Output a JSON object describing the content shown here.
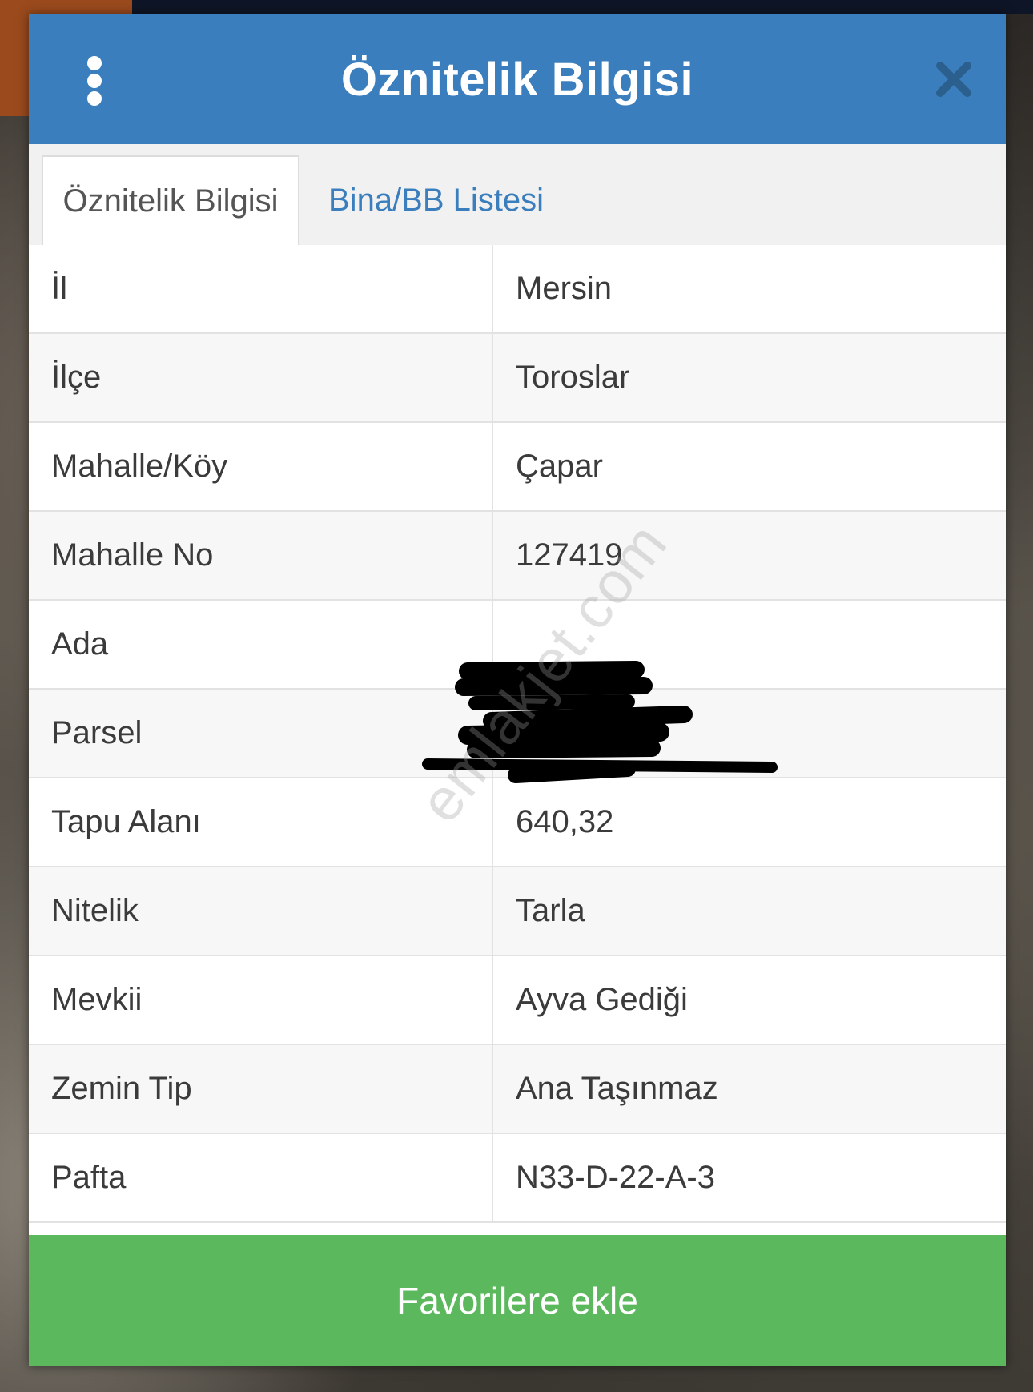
{
  "dialog": {
    "title": "Öznitelik Bilgisi",
    "menu_icon": "kebab-menu-icon",
    "close_icon": "close-icon"
  },
  "tabs": [
    {
      "label": "Öznitelik Bilgisi",
      "active": true
    },
    {
      "label": "Bina/BB Listesi",
      "active": false
    }
  ],
  "attributes": [
    {
      "key": "İl",
      "value": "Mersin"
    },
    {
      "key": "İlçe",
      "value": "Toroslar"
    },
    {
      "key": "Mahalle/Köy",
      "value": "Çapar"
    },
    {
      "key": "Mahalle No",
      "value": "127419"
    },
    {
      "key": "Ada",
      "value": ""
    },
    {
      "key": "Parsel",
      "value": ""
    },
    {
      "key": "Tapu Alanı",
      "value": "640,32"
    },
    {
      "key": "Nitelik",
      "value": "Tarla"
    },
    {
      "key": "Mevkii",
      "value": "Ayva Gediği"
    },
    {
      "key": "Zemin Tip",
      "value": "Ana Taşınmaz"
    },
    {
      "key": "Pafta",
      "value": "N33-D-22-A-3"
    }
  ],
  "watermark": "emlakjet.com",
  "favorite_button": {
    "label": "Favorilere ekle"
  },
  "colors": {
    "header": "#3a7ebd",
    "tab_link": "#3a7ebd",
    "button": "#5cb85c"
  }
}
